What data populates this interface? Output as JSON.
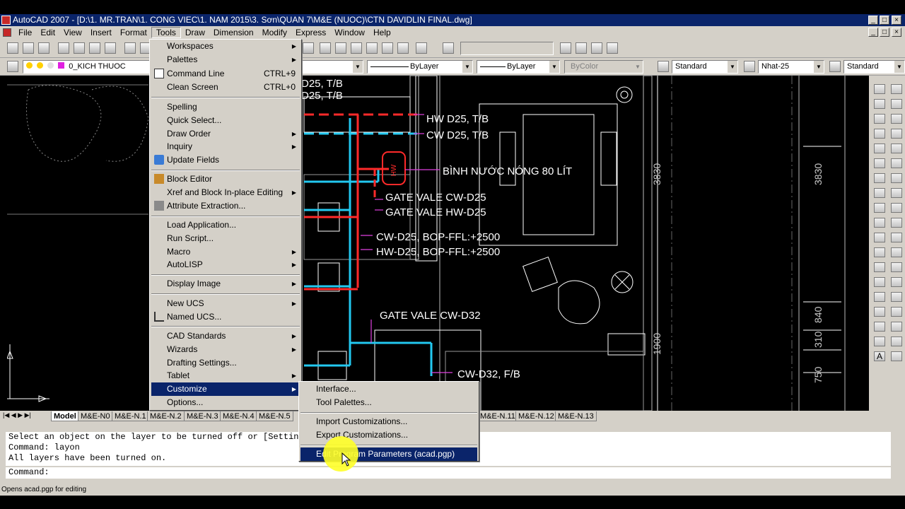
{
  "window": {
    "title": "AutoCAD 2007 - [D:\\1. MR.TRAN\\1. CONG VIEC\\1. NAM 2015\\3. Sơn\\QUAN 7\\M&E (NUOC)\\CTN DAVIDLIN FINAL.dwg]"
  },
  "menubar": {
    "items": [
      "File",
      "Edit",
      "View",
      "Insert",
      "Format",
      "Tools",
      "Draw",
      "Dimension",
      "Modify",
      "Express",
      "Window",
      "Help"
    ],
    "active": "Tools"
  },
  "toolbar2": {
    "layer": "0_KICH THUOC",
    "linetype": "ByLayer",
    "lineweight": "ByLayer",
    "plotstyle": "ByColor",
    "textstyle": "Standard",
    "dimstyle": "Nhat-25",
    "tablestyle": "Standard"
  },
  "tools_menu": [
    {
      "label": "Workspaces",
      "submenu": true
    },
    {
      "label": "Palettes",
      "submenu": true
    },
    {
      "label": "Command Line",
      "shortcut": "CTRL+9",
      "icon": true
    },
    {
      "label": "Clean Screen",
      "shortcut": "CTRL+0"
    },
    {
      "label": "Spelling"
    },
    {
      "label": "Quick Select..."
    },
    {
      "label": "Draw Order",
      "submenu": true
    },
    {
      "label": "Inquiry",
      "submenu": true
    },
    {
      "label": "Update Fields",
      "icon": true
    },
    {
      "label": "Block Editor",
      "icon": true
    },
    {
      "label": "Xref and Block In-place Editing",
      "submenu": true
    },
    {
      "label": "Attribute Extraction...",
      "icon": true
    },
    {
      "label": "Load Application..."
    },
    {
      "label": "Run Script..."
    },
    {
      "label": "Macro",
      "submenu": true
    },
    {
      "label": "AutoLISP",
      "submenu": true
    },
    {
      "label": "Display Image",
      "submenu": true
    },
    {
      "label": "New UCS",
      "submenu": true
    },
    {
      "label": "Named UCS...",
      "icon": true
    },
    {
      "label": "CAD Standards",
      "submenu": true
    },
    {
      "label": "Wizards",
      "submenu": true
    },
    {
      "label": "Drafting Settings..."
    },
    {
      "label": "Tablet",
      "submenu": true
    },
    {
      "label": "Customize",
      "submenu": true,
      "highlighted": true
    },
    {
      "label": "Options..."
    }
  ],
  "customize_menu": [
    {
      "label": "Interface..."
    },
    {
      "label": "Tool Palettes..."
    },
    {
      "label": "Import Customizations..."
    },
    {
      "label": "Export Customizations..."
    },
    {
      "label": "Edit Program Parameters (acad.pgp)",
      "highlighted": true
    }
  ],
  "drawing": {
    "labels": [
      "D25, T/B",
      "D25, T/B",
      "HW D25, T/B",
      "CW D25, T/B",
      "BÌNH NƯỚC NÓNG 80 LÍT",
      "GATE VALE CW-D25",
      "GATE VALE HW-D25",
      "CW-D25, BOP-FFL:+2500",
      "HW-D25, BOP-FFL:+2500",
      "GATE VALE CW-D32",
      "CW-D32, F/B"
    ],
    "tank_label": "HW",
    "dims": [
      "3830",
      "3830",
      "840",
      "310",
      "750",
      "1900"
    ],
    "colors": {
      "cold_water": "#22c8f0",
      "hot_water": "#ff2a2a",
      "leader": "#e040e0",
      "lines": "#ffffff"
    }
  },
  "layout_tabs": [
    "Model",
    "M&E-N0",
    "M&E-N.1",
    "M&E-N.2",
    "M&E-N.3",
    "M&E-N.4",
    "M&E-N.5",
    "M&E-N.11",
    "M&E-N.12",
    "M&E-N.13"
  ],
  "command_history": [
    "Select an object on the layer to be turned off or [Settings/Undo]:",
    "Command: layon",
    "All layers have been turned on."
  ],
  "command_prompt": "Command:",
  "status_text": "Opens acad.pgp for editing"
}
